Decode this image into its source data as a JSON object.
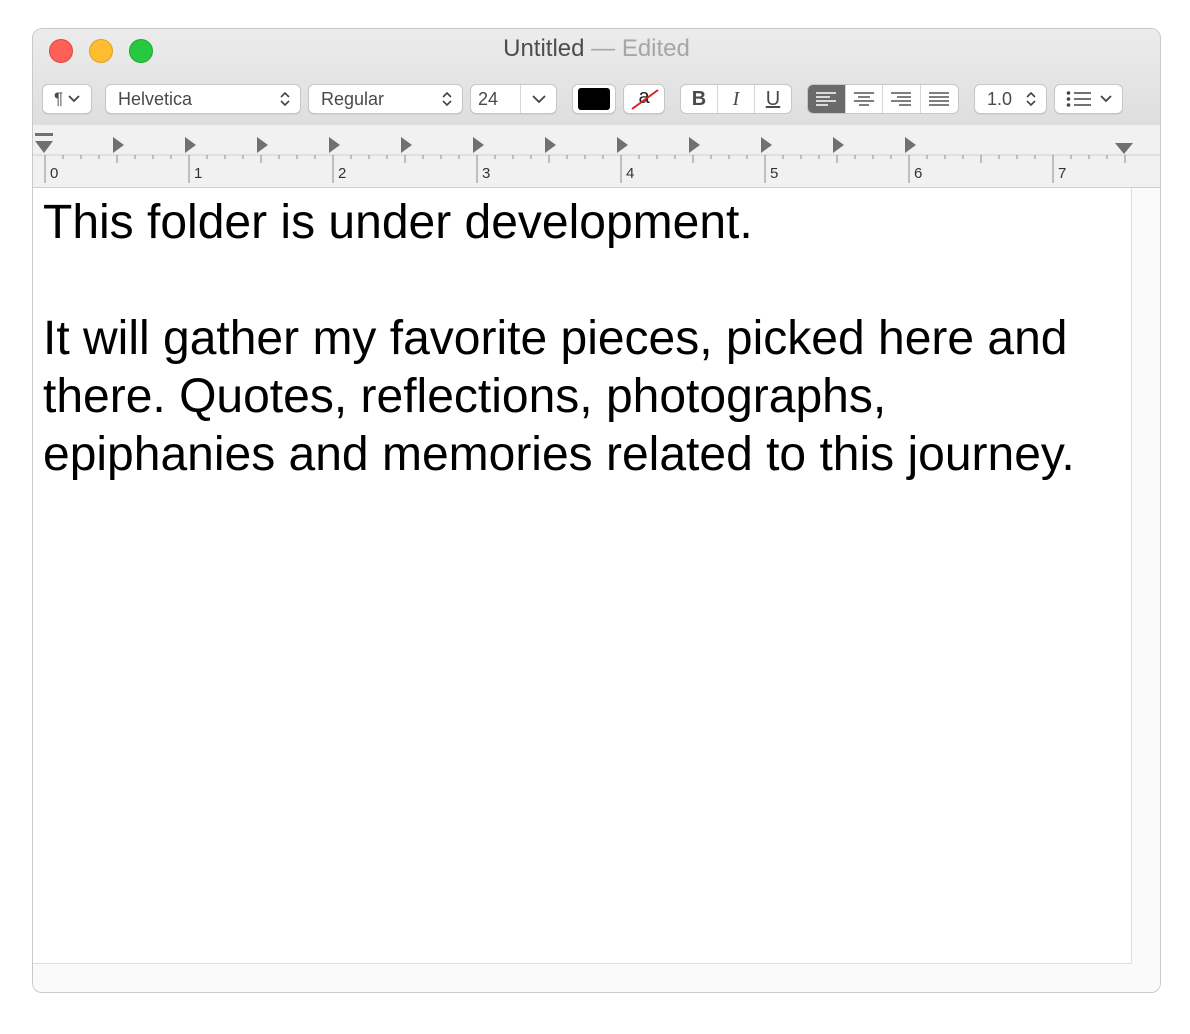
{
  "window": {
    "title": "Untitled",
    "title_separator": "—",
    "title_status": "Edited"
  },
  "toolbar": {
    "paragraph_styles_icon": "¶",
    "font_family": "Helvetica",
    "font_style": "Regular",
    "font_size": "24",
    "text_color": "#000000",
    "background_color_icon": "a",
    "bold_label": "B",
    "italic_label": "I",
    "underline_label": "U",
    "alignment_selected": "left",
    "line_spacing": "1.0"
  },
  "ruler": {
    "numbers": [
      "0",
      "1",
      "2",
      "3",
      "4",
      "5",
      "6",
      "7"
    ]
  },
  "document": {
    "line1": "This folder is under development.",
    "para2_line1": "It will gather my favorite pieces, picked here and",
    "para2_line2": "there. Quotes, reflections, photographs,",
    "para2_line3": "epiphanies and memories related to this journey."
  }
}
